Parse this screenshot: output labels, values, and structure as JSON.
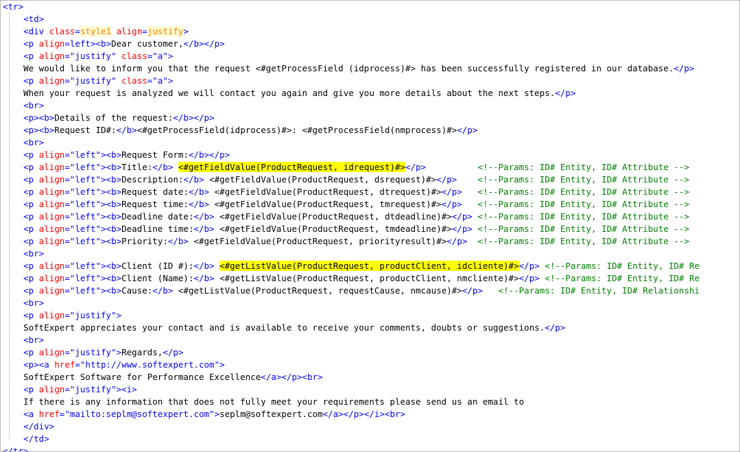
{
  "editor": {
    "lines": [
      [
        [
          "t",
          "<tr>"
        ]
      ],
      [
        [
          "x",
          "    "
        ],
        [
          "t",
          "<td>"
        ]
      ],
      [
        [
          "x",
          "    "
        ],
        [
          "t",
          "<div "
        ],
        [
          "a",
          "class"
        ],
        [
          "t",
          "="
        ],
        [
          "o",
          "style1"
        ],
        [
          "x",
          " "
        ],
        [
          "a",
          "align"
        ],
        [
          "t",
          "="
        ],
        [
          "o",
          "justify"
        ],
        [
          "t",
          ">"
        ]
      ],
      [
        [
          "x",
          "    "
        ],
        [
          "t",
          "<p "
        ],
        [
          "a",
          "align"
        ],
        [
          "t",
          "="
        ],
        [
          "v",
          "left"
        ],
        [
          "t",
          ">"
        ],
        [
          "t",
          "<b>"
        ],
        [
          "x",
          "Dear customer,"
        ],
        [
          "t",
          "</b></p>"
        ]
      ],
      [
        [
          "x",
          "    "
        ],
        [
          "t",
          "<p "
        ],
        [
          "a",
          "align"
        ],
        [
          "t",
          "="
        ],
        [
          "v",
          "\"justify\""
        ],
        [
          "x",
          " "
        ],
        [
          "a",
          "class"
        ],
        [
          "t",
          "="
        ],
        [
          "v",
          "\"a\""
        ],
        [
          "t",
          ">"
        ]
      ],
      [
        [
          "x",
          "    We would like to inform you that the request <#getProcessField (idprocess)#> has been successfully registered in our database."
        ],
        [
          "t",
          "</p>"
        ]
      ],
      [
        [
          "x",
          "    "
        ],
        [
          "t",
          "<p "
        ],
        [
          "a",
          "align"
        ],
        [
          "t",
          "="
        ],
        [
          "v",
          "\"justify\""
        ],
        [
          "x",
          " "
        ],
        [
          "a",
          "class"
        ],
        [
          "t",
          "="
        ],
        [
          "v",
          "\"a\""
        ],
        [
          "t",
          ">"
        ]
      ],
      [
        [
          "x",
          "    When your request is analyzed we will contact you again and give you more details about the next steps."
        ],
        [
          "t",
          "</p>"
        ]
      ],
      [
        [
          "x",
          "    "
        ],
        [
          "t",
          "<br>"
        ]
      ],
      [
        [
          "x",
          "    "
        ],
        [
          "t",
          "<p><b>"
        ],
        [
          "x",
          "Details of the request:"
        ],
        [
          "t",
          "</b></p>"
        ]
      ],
      [
        [
          "x",
          "    "
        ],
        [
          "t",
          "<p><b>"
        ],
        [
          "x",
          "Request ID#:"
        ],
        [
          "t",
          "</b>"
        ],
        [
          "x",
          "<#getProcessField(idprocess)#>: <#getProcessField(nmprocess)#>"
        ],
        [
          "t",
          "</p>"
        ]
      ],
      [
        [
          "x",
          "    "
        ],
        [
          "t",
          "<br>"
        ]
      ],
      [
        [
          "x",
          "    "
        ],
        [
          "t",
          "<p "
        ],
        [
          "a",
          "align"
        ],
        [
          "t",
          "="
        ],
        [
          "v",
          "\"left\""
        ],
        [
          "t",
          "><b>"
        ],
        [
          "x",
          "Request Form:"
        ],
        [
          "t",
          "</b></p>"
        ]
      ],
      [
        [
          "x",
          "    "
        ],
        [
          "t",
          "<p "
        ],
        [
          "a",
          "align"
        ],
        [
          "t",
          "="
        ],
        [
          "v",
          "\"left\""
        ],
        [
          "t",
          "><b>"
        ],
        [
          "x",
          "Title:"
        ],
        [
          "t",
          "</b>"
        ],
        [
          "x",
          " "
        ],
        [
          "h",
          "<#getFieldValue(ProductRequest, idrequest)#>"
        ],
        [
          "t",
          "</p>"
        ],
        [
          "x",
          "          "
        ],
        [
          "c",
          "<!--Params: ID# Entity, ID# Attribute -->"
        ]
      ],
      [
        [
          "x",
          "    "
        ],
        [
          "t",
          "<p "
        ],
        [
          "a",
          "align"
        ],
        [
          "t",
          "="
        ],
        [
          "v",
          "\"left\""
        ],
        [
          "t",
          "><b>"
        ],
        [
          "x",
          "Description:"
        ],
        [
          "t",
          "</b>"
        ],
        [
          "x",
          " <#getFieldValue(ProductRequest, dsrequest)#>"
        ],
        [
          "t",
          "</p>"
        ],
        [
          "x",
          "    "
        ],
        [
          "c",
          "<!--Params: ID# Entity, ID# Attribute -->"
        ]
      ],
      [
        [
          "x",
          "    "
        ],
        [
          "t",
          "<p "
        ],
        [
          "a",
          "align"
        ],
        [
          "t",
          "="
        ],
        [
          "v",
          "\"left\""
        ],
        [
          "t",
          "><b>"
        ],
        [
          "x",
          "Request date:"
        ],
        [
          "t",
          "</b>"
        ],
        [
          "x",
          " <#getFieldValue(ProductRequest, dtrequest)#>"
        ],
        [
          "t",
          "</p>"
        ],
        [
          "x",
          "   "
        ],
        [
          "c",
          "<!--Params: ID# Entity, ID# Attribute -->"
        ]
      ],
      [
        [
          "x",
          "    "
        ],
        [
          "t",
          "<p "
        ],
        [
          "a",
          "align"
        ],
        [
          "t",
          "="
        ],
        [
          "v",
          "\"left\""
        ],
        [
          "t",
          "><b>"
        ],
        [
          "x",
          "Request time:"
        ],
        [
          "t",
          "</b>"
        ],
        [
          "x",
          " <#getFieldValue(ProductRequest, tmrequest)#>"
        ],
        [
          "t",
          "</p>"
        ],
        [
          "x",
          "   "
        ],
        [
          "c",
          "<!--Params: ID# Entity, ID# Attribute -->"
        ]
      ],
      [
        [
          "x",
          "    "
        ],
        [
          "t",
          "<p "
        ],
        [
          "a",
          "align"
        ],
        [
          "t",
          "="
        ],
        [
          "v",
          "\"left\""
        ],
        [
          "t",
          "><b>"
        ],
        [
          "x",
          "Deadline date:"
        ],
        [
          "t",
          "</b>"
        ],
        [
          "x",
          " <#getFieldValue(ProductRequest, dtdeadline)#>"
        ],
        [
          "t",
          "</p>"
        ],
        [
          "x",
          " "
        ],
        [
          "c",
          "<!--Params: ID# Entity, ID# Attribute -->"
        ]
      ],
      [
        [
          "x",
          "    "
        ],
        [
          "t",
          "<p "
        ],
        [
          "a",
          "align"
        ],
        [
          "t",
          "="
        ],
        [
          "v",
          "\"left\""
        ],
        [
          "t",
          "><b>"
        ],
        [
          "x",
          "Deadline time:"
        ],
        [
          "t",
          "</b>"
        ],
        [
          "x",
          " <#getFieldValue(ProductRequest, tmdeadline)#>"
        ],
        [
          "t",
          "</p>"
        ],
        [
          "x",
          " "
        ],
        [
          "c",
          "<!--Params: ID# Entity, ID# Attribute -->"
        ]
      ],
      [
        [
          "x",
          "    "
        ],
        [
          "t",
          "<p "
        ],
        [
          "a",
          "align"
        ],
        [
          "t",
          "="
        ],
        [
          "v",
          "\"left\""
        ],
        [
          "t",
          "><b>"
        ],
        [
          "x",
          "Priority:"
        ],
        [
          "t",
          "</b>"
        ],
        [
          "x",
          " <#getFieldValue(ProductRequest, priorityresult)#>"
        ],
        [
          "t",
          "</p>"
        ],
        [
          "x",
          "  "
        ],
        [
          "c",
          "<!--Params: ID# Entity, ID# Attribute -->"
        ]
      ],
      [
        [
          "x",
          "    "
        ],
        [
          "t",
          "<br>"
        ]
      ],
      [
        [
          "x",
          "    "
        ],
        [
          "t",
          "<p "
        ],
        [
          "a",
          "align"
        ],
        [
          "t",
          "="
        ],
        [
          "v",
          "\"left\""
        ],
        [
          "t",
          "><b>"
        ],
        [
          "x",
          "Client (ID #):"
        ],
        [
          "t",
          "</b>"
        ],
        [
          "x",
          " "
        ],
        [
          "h",
          "<#getListValue(ProductRequest, productClient, idcliente)#>"
        ],
        [
          "t",
          "</p>"
        ],
        [
          "x",
          " "
        ],
        [
          "c",
          "<!--Params: ID# Entity, ID# Re"
        ]
      ],
      [
        [
          "x",
          "    "
        ],
        [
          "t",
          "<p "
        ],
        [
          "a",
          "align"
        ],
        [
          "t",
          "="
        ],
        [
          "v",
          "\"left\""
        ],
        [
          "t",
          "><b>"
        ],
        [
          "x",
          "Client (Name):"
        ],
        [
          "t",
          "</b>"
        ],
        [
          "x",
          " <#getListValue(ProductRequest, productClient, nmcliente)#>"
        ],
        [
          "t",
          "</p>"
        ],
        [
          "x",
          " "
        ],
        [
          "c",
          "<!--Params: ID# Entity, ID# Re"
        ]
      ],
      [
        [
          "x",
          "    "
        ],
        [
          "t",
          "<p "
        ],
        [
          "a",
          "align"
        ],
        [
          "t",
          "="
        ],
        [
          "v",
          "\"left\""
        ],
        [
          "t",
          "><b>"
        ],
        [
          "x",
          "Cause:"
        ],
        [
          "t",
          "</b>"
        ],
        [
          "x",
          " <#getListValue(ProductRequest, requestCause, nmcause)#>"
        ],
        [
          "t",
          "</p>"
        ],
        [
          "x",
          "   "
        ],
        [
          "c",
          "<!--Params: ID# Entity, ID# Relationshi"
        ]
      ],
      [
        [
          "x",
          "    "
        ],
        [
          "t",
          "<br>"
        ]
      ],
      [
        [
          "x",
          "    "
        ],
        [
          "t",
          "<p "
        ],
        [
          "a",
          "align"
        ],
        [
          "t",
          "="
        ],
        [
          "v",
          "\"justify\""
        ],
        [
          "t",
          ">"
        ]
      ],
      [
        [
          "x",
          "    SoftExpert appreciates your contact and is available to receive your comments, doubts or suggestions."
        ],
        [
          "t",
          "</p>"
        ]
      ],
      [
        [
          "x",
          "    "
        ],
        [
          "t",
          "<br>"
        ]
      ],
      [
        [
          "x",
          "    "
        ],
        [
          "t",
          "<p "
        ],
        [
          "a",
          "align"
        ],
        [
          "t",
          "="
        ],
        [
          "v",
          "\"justify\""
        ],
        [
          "t",
          ">"
        ],
        [
          "x",
          "Regards,"
        ],
        [
          "t",
          "</p>"
        ]
      ],
      [
        [
          "x",
          "    "
        ],
        [
          "t",
          "<p><a "
        ],
        [
          "a",
          "href"
        ],
        [
          "t",
          "="
        ],
        [
          "v",
          "\"http://www.softexpert.com\""
        ],
        [
          "t",
          ">"
        ]
      ],
      [
        [
          "x",
          "    SoftExpert Software for Performance Excellence"
        ],
        [
          "t",
          "</a></p><br>"
        ]
      ],
      [
        [
          "x",
          "    "
        ],
        [
          "t",
          "<p "
        ],
        [
          "a",
          "align"
        ],
        [
          "t",
          "="
        ],
        [
          "v",
          "\"justify\""
        ],
        [
          "t",
          "><i>"
        ]
      ],
      [
        [
          "x",
          "    If there is any information that does not fully meet your requirements please send us an email to"
        ]
      ],
      [
        [
          "x",
          "    "
        ],
        [
          "t",
          "<a "
        ],
        [
          "a",
          "href"
        ],
        [
          "t",
          "="
        ],
        [
          "v",
          "\"mailto:seplm@softexpert.com\""
        ],
        [
          "t",
          ">"
        ],
        [
          "x",
          "seplm@softexpert.com"
        ],
        [
          "t",
          "</a></p></i><br>"
        ]
      ],
      [
        [
          "x",
          "    "
        ],
        [
          "t",
          "</div>"
        ]
      ],
      [
        [
          "x",
          "    "
        ],
        [
          "t",
          "</td>"
        ]
      ],
      [
        [
          "t",
          "</tr>"
        ]
      ]
    ]
  }
}
